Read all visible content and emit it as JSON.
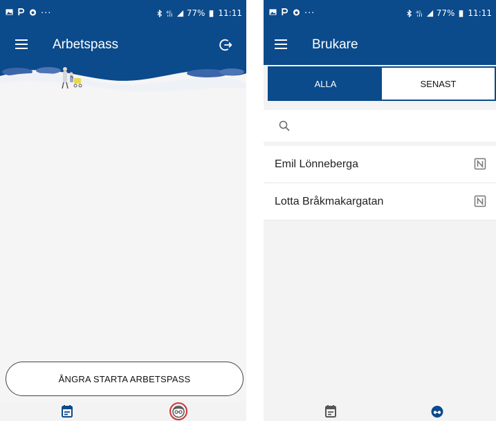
{
  "left_screen": {
    "status": {
      "dots": "...",
      "battery": "77%",
      "time": "11:11"
    },
    "appbar": {
      "title": "Arbetspass"
    },
    "actions": {
      "undo_label": "ÅNGRA STARTA ARBETSPASS"
    },
    "nav": {
      "items": [
        "calendar-shifts",
        "users"
      ],
      "selected": "users"
    }
  },
  "right_screen": {
    "status": {
      "dots": "...",
      "battery": "77%",
      "time": "11:11"
    },
    "appbar": {
      "title": "Brukare"
    },
    "tabs": [
      {
        "label": "ALLA",
        "active": true
      },
      {
        "label": "SENAST",
        "active": false
      }
    ],
    "search": {
      "value": "",
      "placeholder": ""
    },
    "users": [
      {
        "name": "Emil Lönneberga",
        "icon": "nfc-icon"
      },
      {
        "name": "Lotta Bråkmakargatan",
        "icon": "nfc-icon"
      }
    ],
    "nav": {
      "items": [
        "calendar-shifts",
        "users"
      ],
      "selected": "users"
    }
  },
  "colors": {
    "primary": "#0b4a8b",
    "accent_ring": "#cc3333",
    "background": "#f3f3f3",
    "surface": "#ffffff"
  }
}
